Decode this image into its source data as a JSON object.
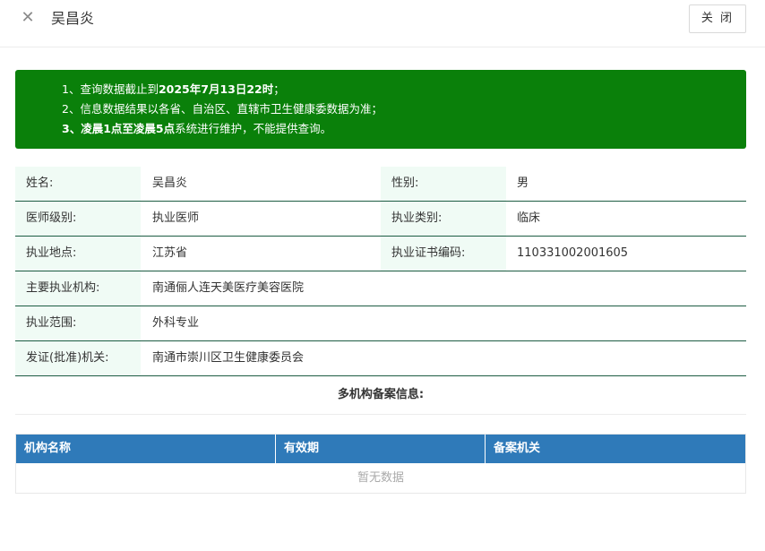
{
  "header": {
    "close_icon": "close-icon",
    "title": "吴昌炎",
    "close_button": "关 闭"
  },
  "notice": {
    "line1_prefix": "1、查询数据截止到",
    "line1_bold": "2025年7月13日22时",
    "line1_suffix": "；",
    "line2": "2、信息数据结果以各省、自治区、直辖市卫生健康委数据为准；",
    "line3_bold": "3、凌晨1点至凌晨5点",
    "line3_suffix": "系统进行维护，不能提供查询。",
    "bg_color": "#0a800a"
  },
  "info": {
    "name_label": "姓名:",
    "name_value": "吴昌炎",
    "gender_label": "性别:",
    "gender_value": "男",
    "level_label": "医师级别:",
    "level_value": "执业医师",
    "type_label": "执业类别:",
    "type_value": "临床",
    "place_label": "执业地点:",
    "place_value": "江苏省",
    "cert_label": "执业证书编码:",
    "cert_value": "110331002001605",
    "org_label": "主要执业机构:",
    "org_value": "南通俪人连天美医疗美容医院",
    "scope_label": "执业范围:",
    "scope_value": "外科专业",
    "issuer_label": "发证(批准)机关:",
    "issuer_value": "南通市崇川区卫生健康委员会"
  },
  "multi_org": {
    "title": "多机构备案信息:"
  },
  "table": {
    "columns": [
      "机构名称",
      "有效期",
      "备案机关"
    ],
    "empty_text": "暂无数据",
    "header_color": "#2f7ab9"
  }
}
